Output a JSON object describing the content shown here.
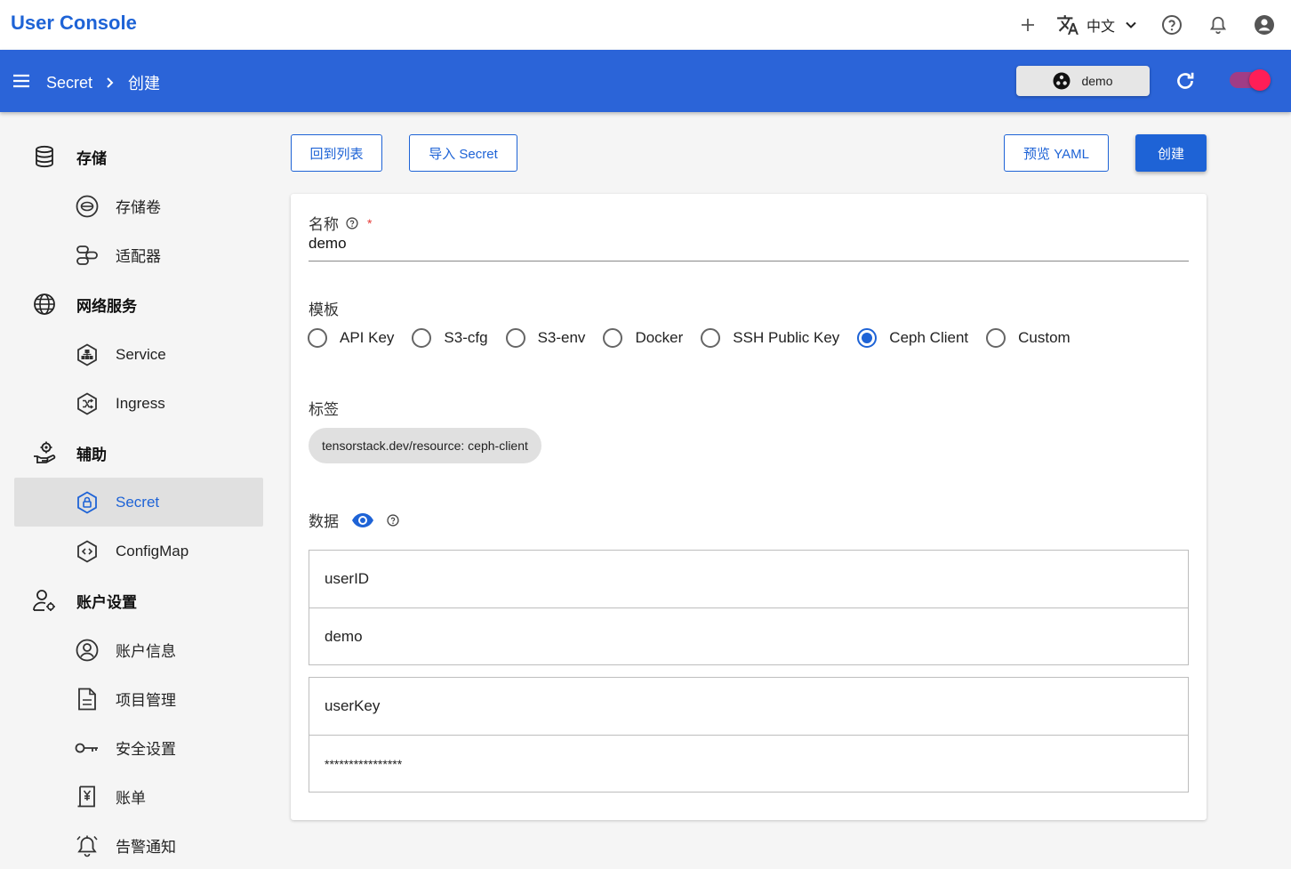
{
  "app": {
    "title": "User Console"
  },
  "topbar": {
    "language": "中文"
  },
  "header": {
    "breadcrumb": [
      "Secret",
      "创建"
    ],
    "namespace": "demo"
  },
  "sidebar": {
    "groups": [
      {
        "label": "存储",
        "icon": "database-icon",
        "items": [
          {
            "label": "存储卷",
            "icon": "volume-icon"
          },
          {
            "label": "适配器",
            "icon": "adapter-icon"
          }
        ]
      },
      {
        "label": "网络服务",
        "icon": "globe-icon",
        "items": [
          {
            "label": "Service",
            "icon": "service-icon"
          },
          {
            "label": "Ingress",
            "icon": "ingress-icon"
          }
        ]
      },
      {
        "label": "辅助",
        "icon": "hand-gear-icon",
        "items": [
          {
            "label": "Secret",
            "icon": "lock-hex-icon",
            "active": true
          },
          {
            "label": "ConfigMap",
            "icon": "code-hex-icon"
          }
        ]
      },
      {
        "label": "账户设置",
        "icon": "user-gear-icon",
        "items": [
          {
            "label": "账户信息",
            "icon": "account-circle-icon"
          },
          {
            "label": "项目管理",
            "icon": "document-icon"
          },
          {
            "label": "安全设置",
            "icon": "key-icon"
          },
          {
            "label": "账单",
            "icon": "bill-icon"
          },
          {
            "label": "告警通知",
            "icon": "alarm-bell-icon"
          }
        ]
      }
    ]
  },
  "toolbar": {
    "back": "回到列表",
    "import": "导入 Secret",
    "preview": "预览 YAML",
    "create": "创建"
  },
  "form": {
    "name_label": "名称",
    "name_value": "demo",
    "template_label": "模板",
    "templates": [
      "API Key",
      "S3-cfg",
      "S3-env",
      "Docker",
      "SSH Public Key",
      "Ceph Client",
      "Custom"
    ],
    "selected_template": "Ceph Client",
    "labels_label": "标签",
    "label_chip": "tensorstack.dev/resource: ceph-client",
    "data_label": "数据",
    "data": [
      {
        "key": "userID",
        "value": "demo"
      },
      {
        "key": "userKey",
        "value": "****************"
      }
    ]
  },
  "colors": {
    "primary": "#1e63d6",
    "header": "#2b64d8",
    "toggle_knob": "#ff1e57"
  }
}
